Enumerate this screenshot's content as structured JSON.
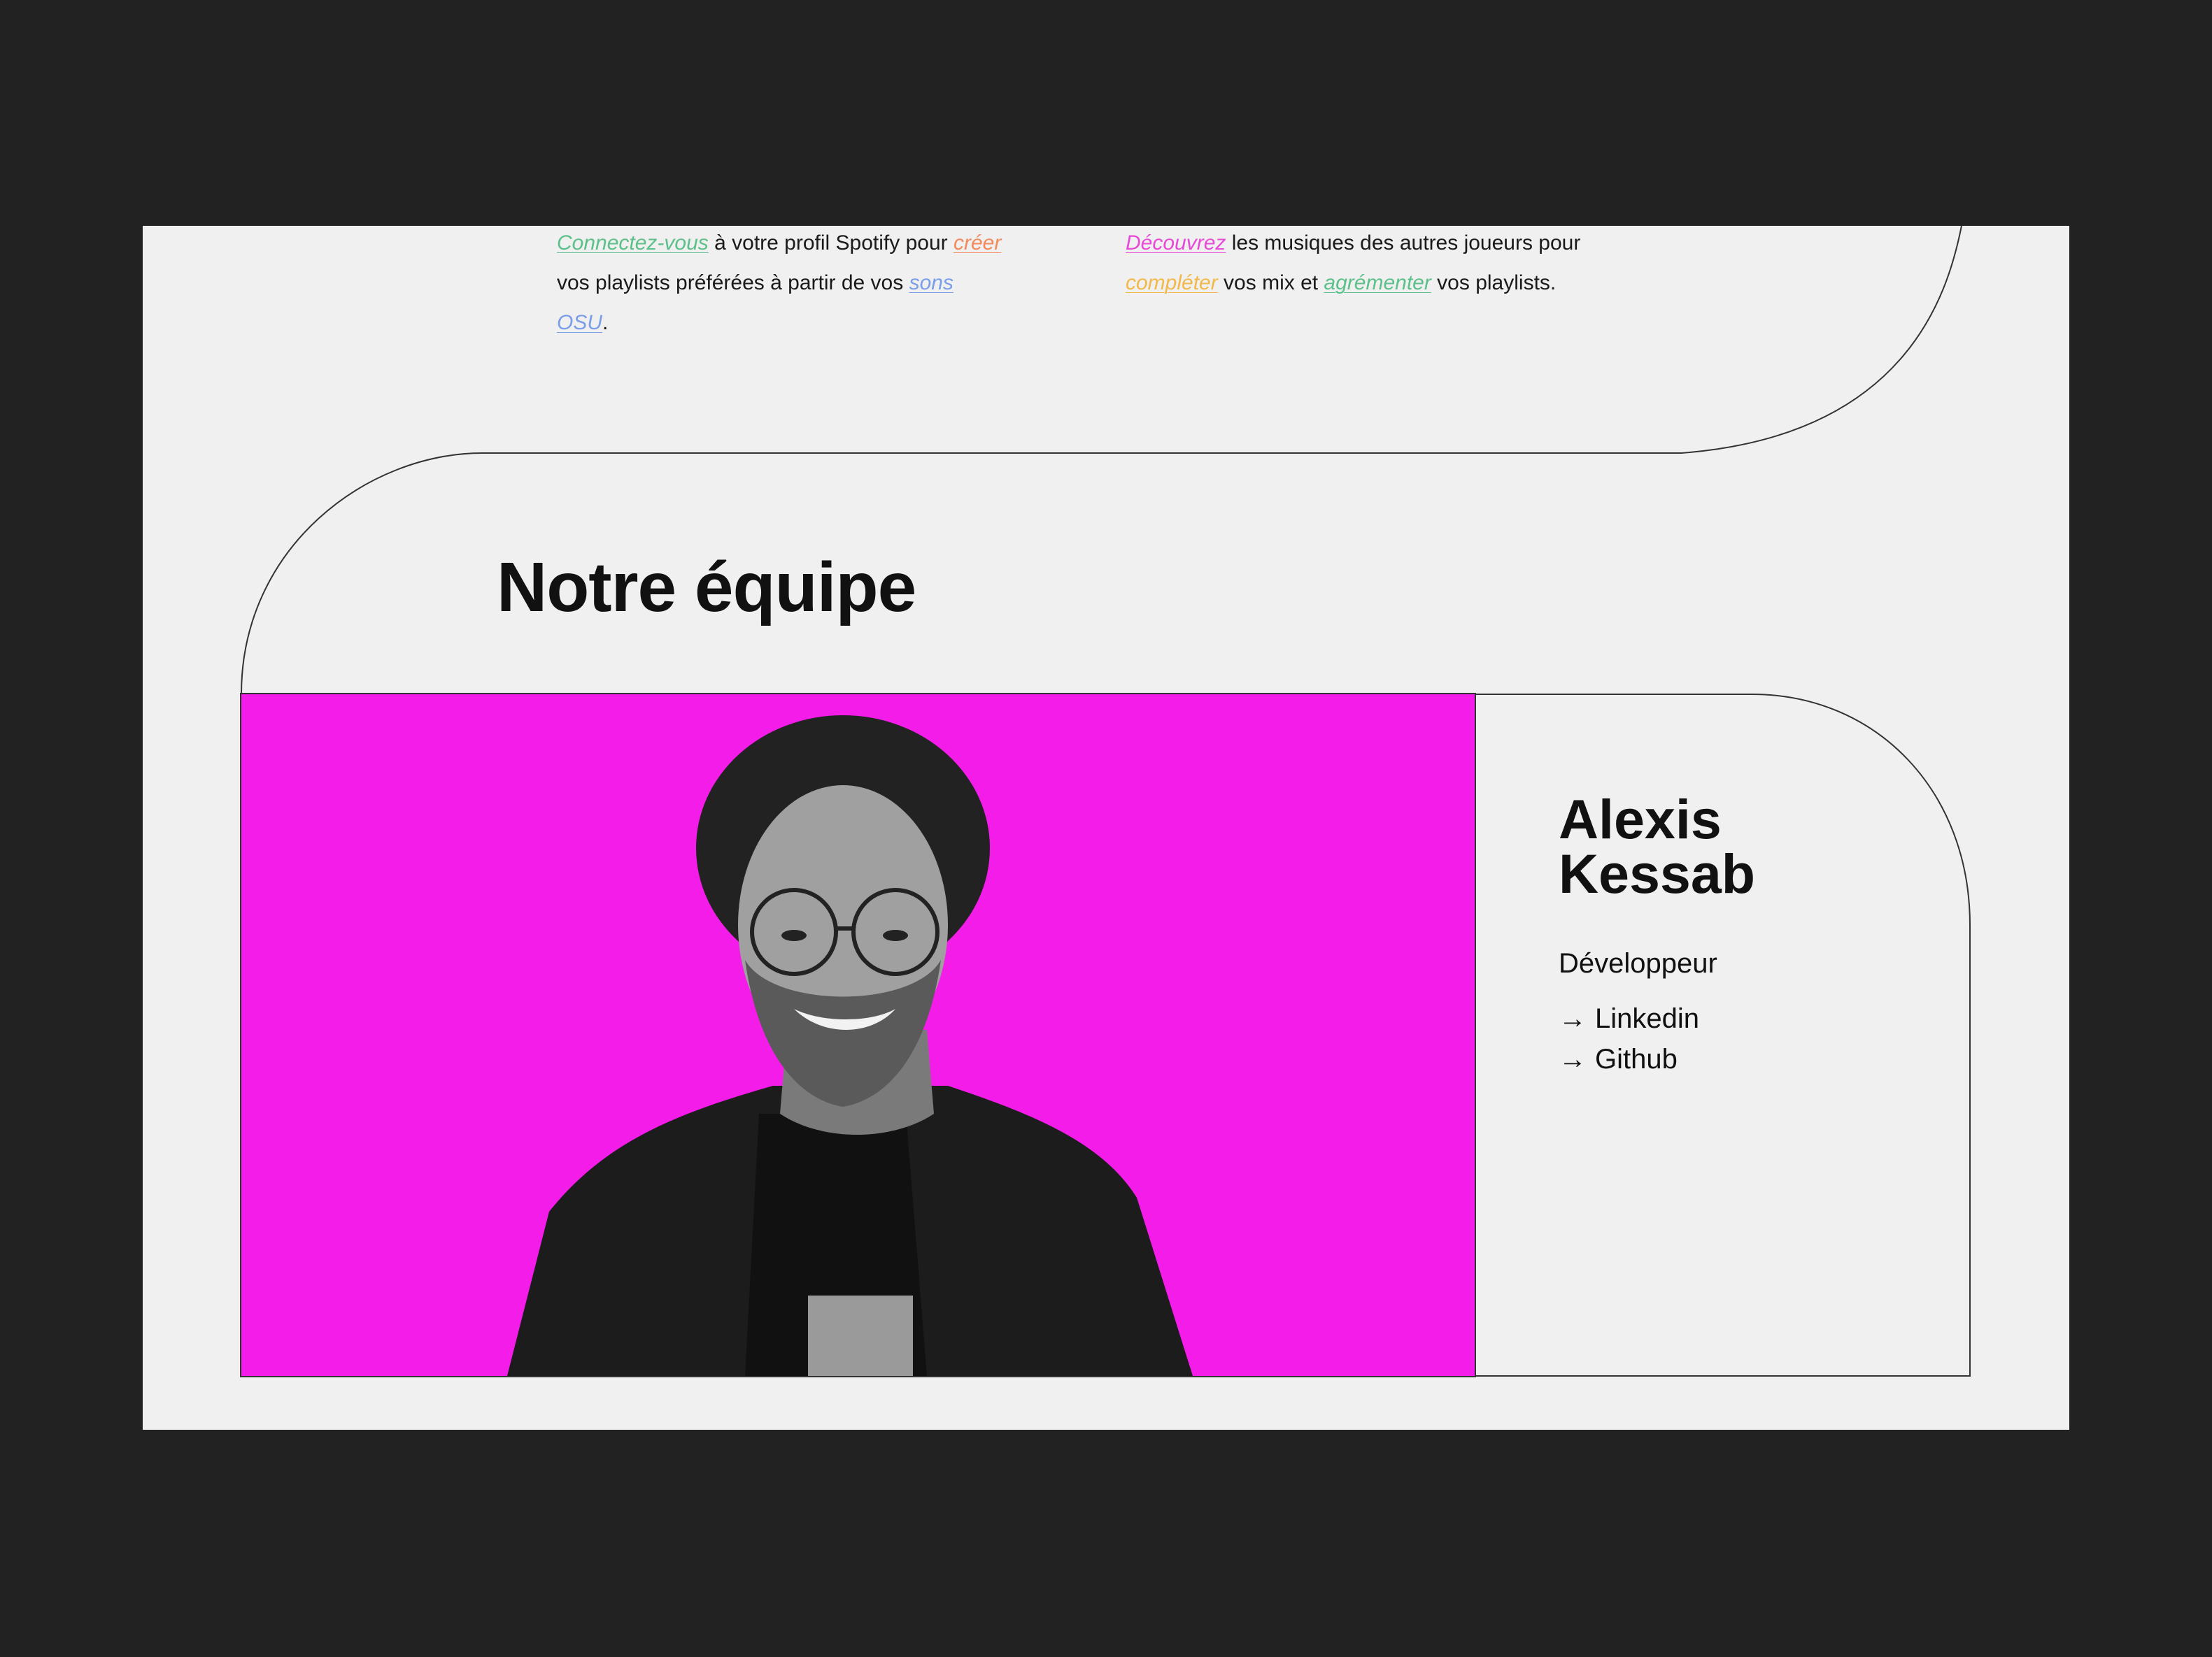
{
  "features": {
    "left": {
      "link1": "Connectez-vous",
      "text1": " à votre profil Spotify pour ",
      "link2": "créer",
      "text2": " vos playlists préférées à partir de vos ",
      "link3": "sons OSU",
      "text3": ".",
      "colors": {
        "link1": "#5cc08a",
        "link2": "#f28a5c",
        "link3": "#7a9ee8"
      }
    },
    "right": {
      "link1": "Découvrez",
      "text1": " les musiques des autres joueurs pour ",
      "link2": "compléter",
      "text2": " vos mix et ",
      "link3": "agrémenter",
      "text3": " vos playlists.",
      "colors": {
        "link1": "#e84ad8",
        "link2": "#f2b84a",
        "link3": "#5cc08a"
      }
    }
  },
  "team": {
    "title": "Notre équipe",
    "member": {
      "first_name": "Alexis",
      "last_name": "Kessab",
      "role": "Développeur",
      "links": [
        {
          "icon": "arrow-right-icon",
          "label": "Linkedin"
        },
        {
          "icon": "arrow-right-icon",
          "label": "Github"
        }
      ],
      "photo_background": "#f41ce9"
    }
  }
}
